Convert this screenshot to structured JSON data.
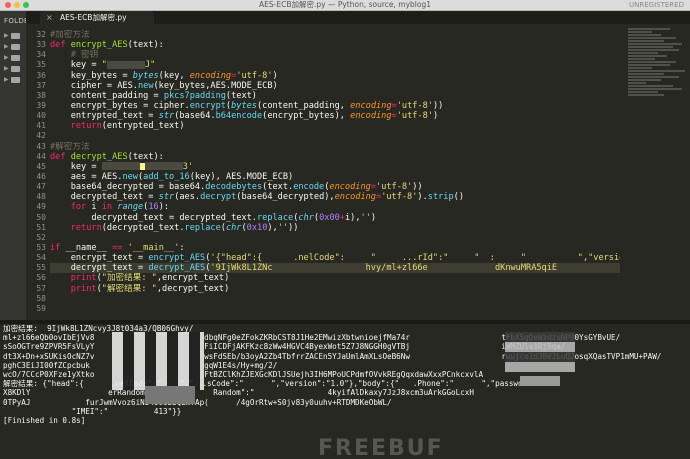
{
  "window": {
    "title": "AES-ECB加解密.py — Python, source, myblog1",
    "unregistered": "UNREGISTERED"
  },
  "sidebar": {
    "folders_label": "FOLDERS",
    "items": [
      {
        "type": "folder"
      },
      {
        "type": "folder"
      },
      {
        "type": "folder"
      },
      {
        "type": "folder"
      },
      {
        "type": "folder"
      }
    ]
  },
  "tabs": [
    {
      "label": "AES-ECB加解密.py",
      "close_glyph": "×"
    }
  ],
  "editor": {
    "line_numbers": [
      "32",
      "33",
      "34",
      "35",
      "36",
      "37",
      "38",
      "39",
      "40",
      "41",
      "42",
      "43",
      "44",
      "45",
      "46",
      "47",
      "48",
      "49",
      "50",
      "51",
      "52",
      "53",
      "54",
      "55",
      "56",
      "57",
      "58",
      "59"
    ],
    "code": {
      "l33_def": "def",
      "l33_name": "encrypt_AES",
      "l33_rest": "(text):",
      "l34": "    # 密钥",
      "l35_a": "    key = ",
      "l35_s": "\"",
      "l35_s2": "J\"",
      "l36_a": "    key_bytes = ",
      "l36_bi": "bytes",
      "l36_b": "(key, ",
      "l36_kw": "encoding",
      "l36_eq": "=",
      "l36_s": "'utf-8'",
      "l36_c": ")",
      "l37_a": "    cipher = AES.",
      "l37_mt": "new",
      "l37_b": "(key_bytes,AES.MODE_ECB)",
      "l38_a": "    content_padding = ",
      "l38_mt": "pkcs7padding",
      "l38_b": "(text)",
      "l39_a": "    encrypt_bytes = cipher.",
      "l39_mt": "encrypt",
      "l39_b": "(",
      "l39_bi": "bytes",
      "l39_c": "(content_padding, ",
      "l39_kw": "encoding",
      "l39_eq": "=",
      "l39_s": "'utf-8'",
      "l39_d": "))",
      "l40_a": "    entrypted_text = ",
      "l40_bi": "str",
      "l40_b": "(base64.",
      "l40_mt": "b64encode",
      "l40_c": "(encrypt_bytes), ",
      "l40_kw": "encoding",
      "l40_eq": "=",
      "l40_s": "'utf-8'",
      "l40_d": ")",
      "l41_k": "    return",
      "l41_b": "(entrypted_text)",
      "l43": "#解密方法",
      "l44_def": "def",
      "l44_name": "decrypt_AES",
      "l44_rest": "(text):",
      "l45_a": "    key = ",
      "l45_s": "3'",
      "l46_a": "    aes = AES.",
      "l46_mt": "new",
      "l46_b": "(",
      "l46_mt2": "add_to_16",
      "l46_c": "(key), AES.MODE_ECB)",
      "l47_a": "    base64_decrypted = base64.",
      "l47_mt": "decodebytes",
      "l47_b": "(text.",
      "l47_mt2": "encode",
      "l47_c": "(",
      "l47_kw": "encoding",
      "l47_eq": "=",
      "l47_s": "'utf-8'",
      "l47_d": "))",
      "l48_a": "    decrypted_text = ",
      "l48_bi": "str",
      "l48_b": "(aes.",
      "l48_mt": "decrypt",
      "l48_c": "(base64_decrypted),",
      "l48_kw": "encoding",
      "l48_eq": "=",
      "l48_s": "'utf-8'",
      "l48_d": ").",
      "l48_mt2": "strip",
      "l48_e": "()",
      "l49_k": "    for",
      "l49_a": " i ",
      "l49_k2": "in",
      "l49_b": " ",
      "l49_bi": "range",
      "l49_c": "(",
      "l49_n": "16",
      "l49_d": "):",
      "l50_a": "        decrypted_text = decrypted_text.",
      "l50_mt": "replace",
      "l50_b": "(",
      "l50_bi": "chr",
      "l50_c": "(",
      "l50_n": "0x00",
      "l50_k": "+",
      "l50_d": "i),",
      "l50_s": "''",
      "l50_e": ")",
      "l51_k": "    return",
      "l51_a": "(decrypted_text.",
      "l51_mt": "replace",
      "l51_b": "(",
      "l51_bi": "chr",
      "l51_c": "(",
      "l51_n": "0x10",
      "l51_d": "),",
      "l51_s": "''",
      "l51_e": "))",
      "l53_k": "if",
      "l53_a": " __name__ ",
      "l53_k2": "==",
      "l53_b": " ",
      "l53_s": "'__main__'",
      "l53_c": ":",
      "l54_a": "    encrypt_text = ",
      "l54_mt": "encrypt_AES",
      "l54_b": "(",
      "l54_s": "'{\"head\":{      .nelCode\":     \"     ...rId\":\"     \"  :     \"          \",\"version\":\"1.0\"},\"bo",
      "l55_a": "    decrypt_text = ",
      "l55_mt": "decrypt_AES",
      "l55_b": "(",
      "l55_s": "'9IjWk8L1ZNc                  hvy/ml+zl66e             dKnwuMRA5qiE             .JeZFokZ",
      "l56_k": "    print",
      "l56_b": "(",
      "l56_s": "\"加密结果: \"",
      "l56_c": ",encrypt_text)",
      "l57_k": "    print",
      "l57_b": "(",
      "l57_s": "\"解密结果: \"",
      "l57_c": ",decrypt_text)"
    }
  },
  "output": {
    "lines": [
      "加密结果:  9IjWk8L1ZNcvy3J8t034a3/QB06Ghvy/",
      "ml+zl66eQb0ovIbEjVv8                        dbqNFg0eZFokZKRbCST8J1He2EMwizXbtwnioejfMa74r                    tFbXSgDeWzdzuNP90YsGYBvUE/",
      "sSoOGTre9ZPVR5FsVLyY                        FiICDFjAKFKzc8zWw4HGVC4ByexWot5Z7J8NGGH0gVTBj                    iWMZUlv1Rj5qa/",
      "dt3X+Dn+xSUKisOcNZ7v                        wsFdSEb/b3oyA2Zb4TbfrrZACEn5YJaUmlAmXLsOeB6Nw                    rwujco1d3BVJLuQJosqXQasTVP1mMU+PAW/",
      "pghC3EiJI00fZCpcbuk                         gqW1E4s/Hy+mg/2/",
      "wcO/7CCcP0XFze1yXtko                        FtBZClKhZJEXGcKDlJSUejh3IH6MPoUCPdmfOVvkREgQqxdawXxxPCnkcxvlA",
      "解密结果: {\"head\":{      .nelCode\":\"    \",\"...sCode\":\"      \",\"version\":\"1.0\"},\"body\":{\"   .Phone\":\"      \",\"password\"",
      "X8KDlY                 erRandom\":\"            Random\":\"                4kyifAlDkaxy7JzJ8xcm3uArkGGoLcxH",
      "0TPyAJ            furJwmVvoz6iNb4UoiBbQEm7Ap(      /4gOrRtw+S0jv83y0uuhv+RTDMDKeObWL/",
      "               \"IMEI\":\"          413\"}}",
      "[Finished in 0.8s]"
    ],
    "watermark": "FREEBUF"
  }
}
